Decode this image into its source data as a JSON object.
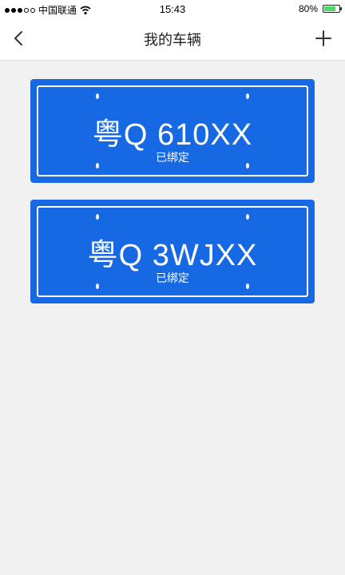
{
  "status_bar": {
    "carrier": "中国联通",
    "time": "15:43",
    "battery_percent": "80%",
    "battery_level": 0.8
  },
  "navbar": {
    "title": "我的车辆",
    "back_icon": "chevron-left-icon",
    "add_icon": "plus-icon"
  },
  "vehicles": [
    {
      "plate": "粤Q 610XX",
      "status": "已绑定"
    },
    {
      "plate": "粤Q 3WJXX",
      "status": "已绑定"
    }
  ],
  "colors": {
    "plate_blue": "#1769e3",
    "background": "#f1f1f1",
    "battery_green": "#4cd964"
  }
}
